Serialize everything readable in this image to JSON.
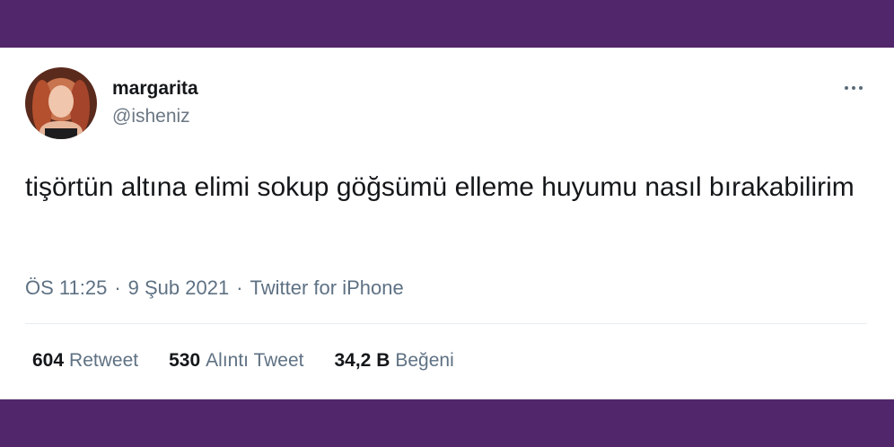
{
  "tweet": {
    "author_name": "margarita",
    "author_handle": "@isheniz",
    "text": "tişörtün altına elimi sokup göğsümü elleme huyumu nasıl bırakabilirim",
    "time": "ÖS 11:25",
    "date": "9 Şub 2021",
    "source": "Twitter for iPhone",
    "separator": "·",
    "more_icon": "more-horizontal-icon"
  },
  "stats": [
    {
      "count": "604",
      "label": "Retweet"
    },
    {
      "count": "530",
      "label": "Alıntı Tweet"
    },
    {
      "count": "34,2 B",
      "label": "Beğeni"
    }
  ],
  "colors": {
    "frame": "#52266a",
    "text": "#14171a",
    "muted": "#5e7183"
  }
}
